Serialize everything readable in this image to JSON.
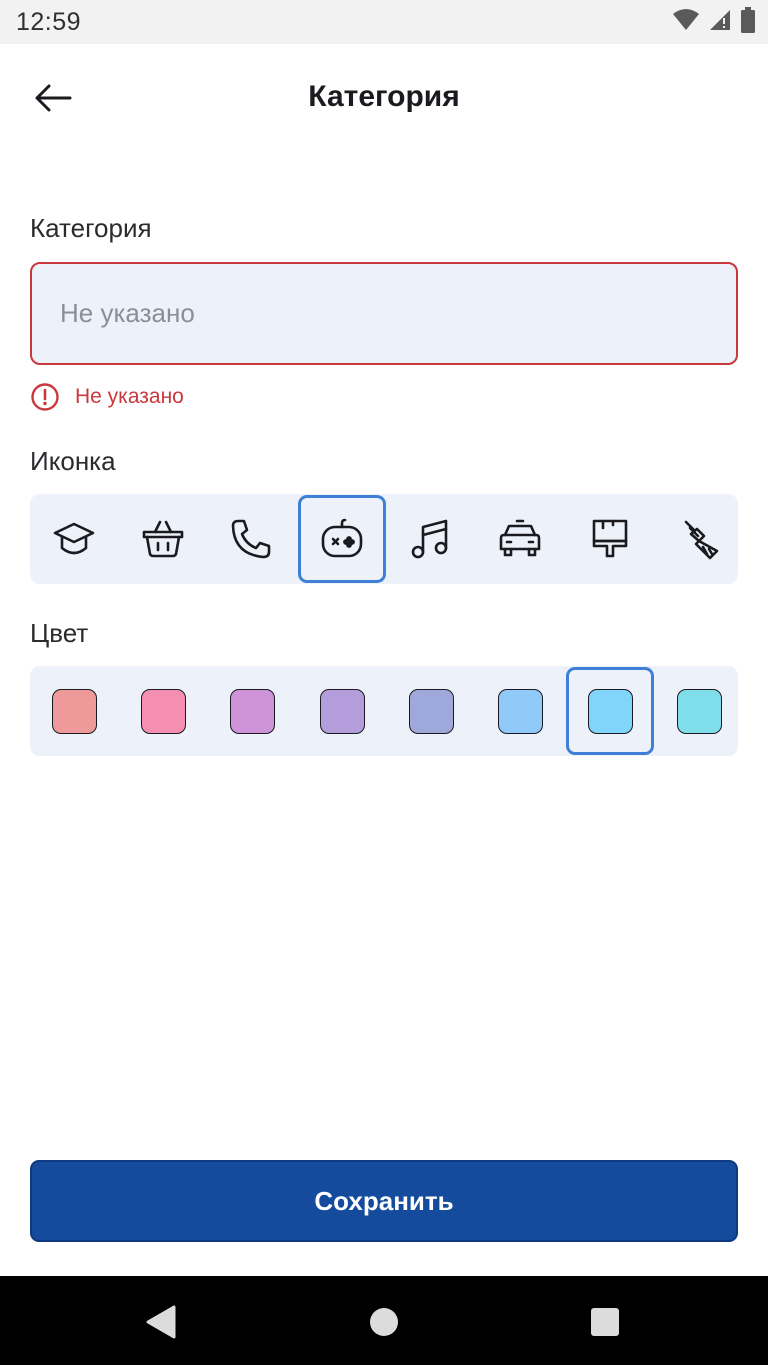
{
  "status_bar": {
    "time": "12:59"
  },
  "header": {
    "title": "Категория"
  },
  "category_field": {
    "label": "Категория",
    "value": "",
    "placeholder": "Не указано",
    "error": "Не указано"
  },
  "icon_section": {
    "label": "Иконка",
    "icons": [
      "graduation-cap",
      "shopping-basket",
      "phone",
      "gamepad",
      "music-note",
      "car",
      "paint-roller",
      "broom"
    ],
    "selected_index": 3
  },
  "color_section": {
    "label": "Цвет",
    "colors": [
      "#ef9a9a",
      "#f48fb1",
      "#ce93d8",
      "#b39ddb",
      "#9fa8da",
      "#90caf9",
      "#81d4fa",
      "#80deea"
    ],
    "selected_index": 6
  },
  "save_button": {
    "label": "Сохранить"
  },
  "theme": {
    "accent": "#154b9c",
    "error": "#c9383d",
    "selected_border": "#3f7fd6",
    "surface": "#edf1fa"
  }
}
